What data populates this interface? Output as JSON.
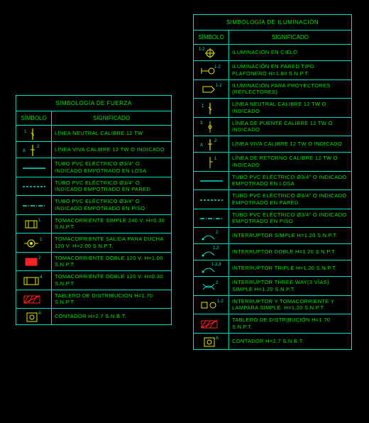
{
  "left": {
    "title": "SIMBOLOGÍA DE FUERZA",
    "header_symbol": "SÍMBOLO",
    "header_meaning": "SIGNIFICADO",
    "rows": [
      {
        "symbol": "neutral-line",
        "meaning": "LÍNEA NEUTRAL CALIBRE 12 TW"
      },
      {
        "symbol": "live-line",
        "meaning": "LÍNEA VIVA CALIBRE 12 TW O INDICADO"
      },
      {
        "symbol": "tube-losa",
        "meaning": "TUBO PVC ELÉCTRICO Ø3/4\" O INDICADO EMPOTRADO EN LOSA"
      },
      {
        "symbol": "tube-pared",
        "meaning": "TUBO PVC ELÉCTRICO Ø3/4\" O INDICADO EMPOTRADO EN PARED"
      },
      {
        "symbol": "tube-piso",
        "meaning": "TUBO PVC ELÉCTRICO Ø3/4\" O INDICADO EMPOTRADO EN PISO"
      },
      {
        "symbol": "toma-simple",
        "meaning": "TOMACORRIENTE SIMPLE 240 V. H=0.30 S.N.P.T."
      },
      {
        "symbol": "toma-ducha",
        "meaning": "TOMACORRIENTE SALIDA PARA DUCHA 120 V. H=2.00 S.N.P.T."
      },
      {
        "symbol": "toma-doble-100",
        "meaning": "TOMACORRIENTE DOBLE 120 V. H=1.00  S.N.P.T."
      },
      {
        "symbol": "toma-doble-030",
        "meaning": "TOMACORRIENTE DOBLE 120 V. H=0.30  S.N.P.T."
      },
      {
        "symbol": "tablero",
        "meaning": "TABLERO DE DISTRIBUCIÓN H=1.70 S.N.P.T."
      },
      {
        "symbol": "contador",
        "meaning": "CONTADOR H=2.7 S.N.B.T."
      }
    ]
  },
  "right": {
    "title": "SIMBOLOGÍA DE ILUMINACIÓN",
    "header_symbol": "SÍMBOLO",
    "header_meaning": "SIGNIFICADO",
    "rows": [
      {
        "symbol": "ilum-cielo",
        "meaning": "ILUMINACIÓN EN CIELO"
      },
      {
        "symbol": "ilum-pared",
        "meaning": "ILUMINACIÓN EN PARED TIPO PLAFONERO H=1.80 S.N.P.T."
      },
      {
        "symbol": "ilum-proy",
        "meaning": "ILUMINACIÓN PARA PROYECTORES (REFLECTORES)"
      },
      {
        "symbol": "neutral-line-r",
        "meaning": "LÍNEA NEUTRAL CALIBRE 12 TW O INDICADO"
      },
      {
        "symbol": "puente-line",
        "meaning": "LÍNEA DE PUENTE CALIBRE 12 TW O INDICADO"
      },
      {
        "symbol": "live-line-r",
        "meaning": "LÍNEA VIVA CALIBRE 12 TW O INDICADO"
      },
      {
        "symbol": "retorno-line",
        "meaning": "LÍNEA DE RETORNO CALIBRE 12 TW O INDICADO"
      },
      {
        "symbol": "tube-losa-r",
        "meaning": "TUBO PVC ELÉCTRICO Ø3/4\" O INDICADO EMPOTRADO EN LOSA"
      },
      {
        "symbol": "tube-pared-r",
        "meaning": "TUBO PVC ELÉCTRICO Ø3/4\" O INDICADO EMPOTRADO EN PARED"
      },
      {
        "symbol": "tube-piso-r",
        "meaning": "TUBO PVC ELÉCTRICO Ø3/4\" O INDICADO EMPOTRADO EN PISO"
      },
      {
        "symbol": "int-simple",
        "meaning": "INTERRUPTOR SIMPLE H=1.20 S.N.P.T."
      },
      {
        "symbol": "int-doble",
        "meaning": "INTERRUPTOR DOBLE H=1.20 S.N.P.T."
      },
      {
        "symbol": "int-triple",
        "meaning": "INTERRUPTOR TRIPLE H=1.20 S.N.P.T."
      },
      {
        "symbol": "int-3way",
        "meaning": "INTERRUPTOR THREE WAY(3 VÍAS) SIMPLE H=1.20 S.N.P.T."
      },
      {
        "symbol": "int-toma-lamp",
        "meaning": "INTERRUPTOR Y TOMACORRIENTE Y LAMPARA SIMPLE. H=1.20 S.N.P.T."
      },
      {
        "symbol": "tablero-r",
        "meaning": "TABLERO DE DISTRIBUCIÓN H=1.70 S.N.P.T."
      },
      {
        "symbol": "contador-r",
        "meaning": "CONTADOR H=2.7 S.N.B.T."
      }
    ]
  }
}
